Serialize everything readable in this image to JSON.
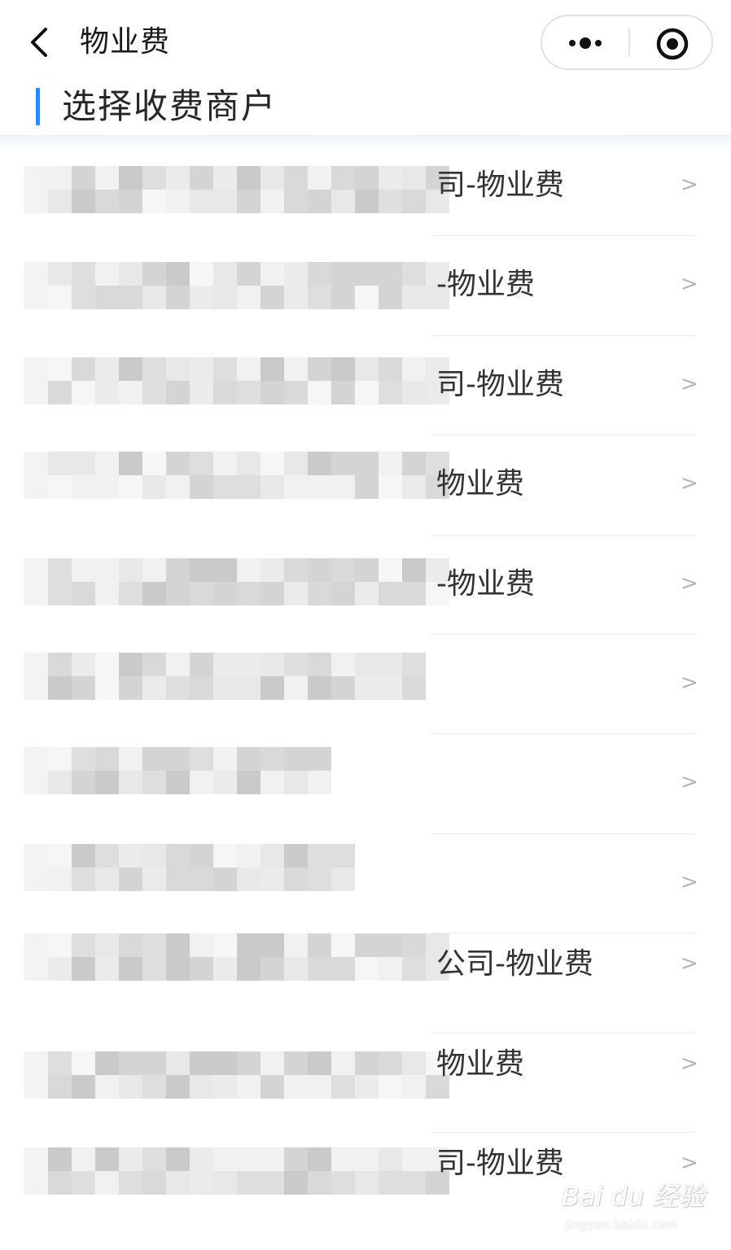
{
  "nav": {
    "title": "物业费",
    "back_icon": "chevron-left-icon",
    "more_icon": "more-dots-icon",
    "close_icon": "record-circle-icon"
  },
  "section": {
    "title": "选择收费商户",
    "accent_color": "#2f86f6"
  },
  "merchants": [
    {
      "visible_text": "司-物业费",
      "redacted": true
    },
    {
      "visible_text": "-物业费",
      "redacted": true
    },
    {
      "visible_text": "司-物业费",
      "redacted": true
    },
    {
      "visible_text": "物业费",
      "redacted": true
    },
    {
      "visible_text": "-物业费",
      "redacted": true
    },
    {
      "visible_text": "",
      "redacted": true
    },
    {
      "visible_text": "",
      "redacted": true
    },
    {
      "visible_text": "",
      "redacted": true
    },
    {
      "visible_text": "公司-物业费",
      "redacted": true
    },
    {
      "visible_text": "物业费",
      "redacted": true
    },
    {
      "visible_text": "司-物业费",
      "redacted": true
    }
  ],
  "row_chevron": ">",
  "watermark": {
    "brand": "Bai du 经验",
    "site": "jingyan.baidu.com"
  }
}
